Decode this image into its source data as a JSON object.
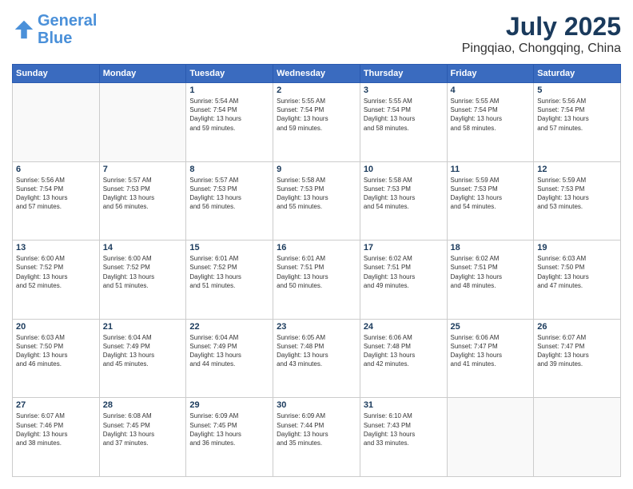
{
  "header": {
    "logo_line1": "General",
    "logo_line2": "Blue",
    "month_title": "July 2025",
    "location": "Pingqiao, Chongqing, China"
  },
  "weekdays": [
    "Sunday",
    "Monday",
    "Tuesday",
    "Wednesday",
    "Thursday",
    "Friday",
    "Saturday"
  ],
  "weeks": [
    [
      {
        "day": "",
        "detail": ""
      },
      {
        "day": "",
        "detail": ""
      },
      {
        "day": "1",
        "detail": "Sunrise: 5:54 AM\nSunset: 7:54 PM\nDaylight: 13 hours\nand 59 minutes."
      },
      {
        "day": "2",
        "detail": "Sunrise: 5:55 AM\nSunset: 7:54 PM\nDaylight: 13 hours\nand 59 minutes."
      },
      {
        "day": "3",
        "detail": "Sunrise: 5:55 AM\nSunset: 7:54 PM\nDaylight: 13 hours\nand 58 minutes."
      },
      {
        "day": "4",
        "detail": "Sunrise: 5:55 AM\nSunset: 7:54 PM\nDaylight: 13 hours\nand 58 minutes."
      },
      {
        "day": "5",
        "detail": "Sunrise: 5:56 AM\nSunset: 7:54 PM\nDaylight: 13 hours\nand 57 minutes."
      }
    ],
    [
      {
        "day": "6",
        "detail": "Sunrise: 5:56 AM\nSunset: 7:54 PM\nDaylight: 13 hours\nand 57 minutes."
      },
      {
        "day": "7",
        "detail": "Sunrise: 5:57 AM\nSunset: 7:53 PM\nDaylight: 13 hours\nand 56 minutes."
      },
      {
        "day": "8",
        "detail": "Sunrise: 5:57 AM\nSunset: 7:53 PM\nDaylight: 13 hours\nand 56 minutes."
      },
      {
        "day": "9",
        "detail": "Sunrise: 5:58 AM\nSunset: 7:53 PM\nDaylight: 13 hours\nand 55 minutes."
      },
      {
        "day": "10",
        "detail": "Sunrise: 5:58 AM\nSunset: 7:53 PM\nDaylight: 13 hours\nand 54 minutes."
      },
      {
        "day": "11",
        "detail": "Sunrise: 5:59 AM\nSunset: 7:53 PM\nDaylight: 13 hours\nand 54 minutes."
      },
      {
        "day": "12",
        "detail": "Sunrise: 5:59 AM\nSunset: 7:53 PM\nDaylight: 13 hours\nand 53 minutes."
      }
    ],
    [
      {
        "day": "13",
        "detail": "Sunrise: 6:00 AM\nSunset: 7:52 PM\nDaylight: 13 hours\nand 52 minutes."
      },
      {
        "day": "14",
        "detail": "Sunrise: 6:00 AM\nSunset: 7:52 PM\nDaylight: 13 hours\nand 51 minutes."
      },
      {
        "day": "15",
        "detail": "Sunrise: 6:01 AM\nSunset: 7:52 PM\nDaylight: 13 hours\nand 51 minutes."
      },
      {
        "day": "16",
        "detail": "Sunrise: 6:01 AM\nSunset: 7:51 PM\nDaylight: 13 hours\nand 50 minutes."
      },
      {
        "day": "17",
        "detail": "Sunrise: 6:02 AM\nSunset: 7:51 PM\nDaylight: 13 hours\nand 49 minutes."
      },
      {
        "day": "18",
        "detail": "Sunrise: 6:02 AM\nSunset: 7:51 PM\nDaylight: 13 hours\nand 48 minutes."
      },
      {
        "day": "19",
        "detail": "Sunrise: 6:03 AM\nSunset: 7:50 PM\nDaylight: 13 hours\nand 47 minutes."
      }
    ],
    [
      {
        "day": "20",
        "detail": "Sunrise: 6:03 AM\nSunset: 7:50 PM\nDaylight: 13 hours\nand 46 minutes."
      },
      {
        "day": "21",
        "detail": "Sunrise: 6:04 AM\nSunset: 7:49 PM\nDaylight: 13 hours\nand 45 minutes."
      },
      {
        "day": "22",
        "detail": "Sunrise: 6:04 AM\nSunset: 7:49 PM\nDaylight: 13 hours\nand 44 minutes."
      },
      {
        "day": "23",
        "detail": "Sunrise: 6:05 AM\nSunset: 7:48 PM\nDaylight: 13 hours\nand 43 minutes."
      },
      {
        "day": "24",
        "detail": "Sunrise: 6:06 AM\nSunset: 7:48 PM\nDaylight: 13 hours\nand 42 minutes."
      },
      {
        "day": "25",
        "detail": "Sunrise: 6:06 AM\nSunset: 7:47 PM\nDaylight: 13 hours\nand 41 minutes."
      },
      {
        "day": "26",
        "detail": "Sunrise: 6:07 AM\nSunset: 7:47 PM\nDaylight: 13 hours\nand 39 minutes."
      }
    ],
    [
      {
        "day": "27",
        "detail": "Sunrise: 6:07 AM\nSunset: 7:46 PM\nDaylight: 13 hours\nand 38 minutes."
      },
      {
        "day": "28",
        "detail": "Sunrise: 6:08 AM\nSunset: 7:45 PM\nDaylight: 13 hours\nand 37 minutes."
      },
      {
        "day": "29",
        "detail": "Sunrise: 6:09 AM\nSunset: 7:45 PM\nDaylight: 13 hours\nand 36 minutes."
      },
      {
        "day": "30",
        "detail": "Sunrise: 6:09 AM\nSunset: 7:44 PM\nDaylight: 13 hours\nand 35 minutes."
      },
      {
        "day": "31",
        "detail": "Sunrise: 6:10 AM\nSunset: 7:43 PM\nDaylight: 13 hours\nand 33 minutes."
      },
      {
        "day": "",
        "detail": ""
      },
      {
        "day": "",
        "detail": ""
      }
    ]
  ]
}
